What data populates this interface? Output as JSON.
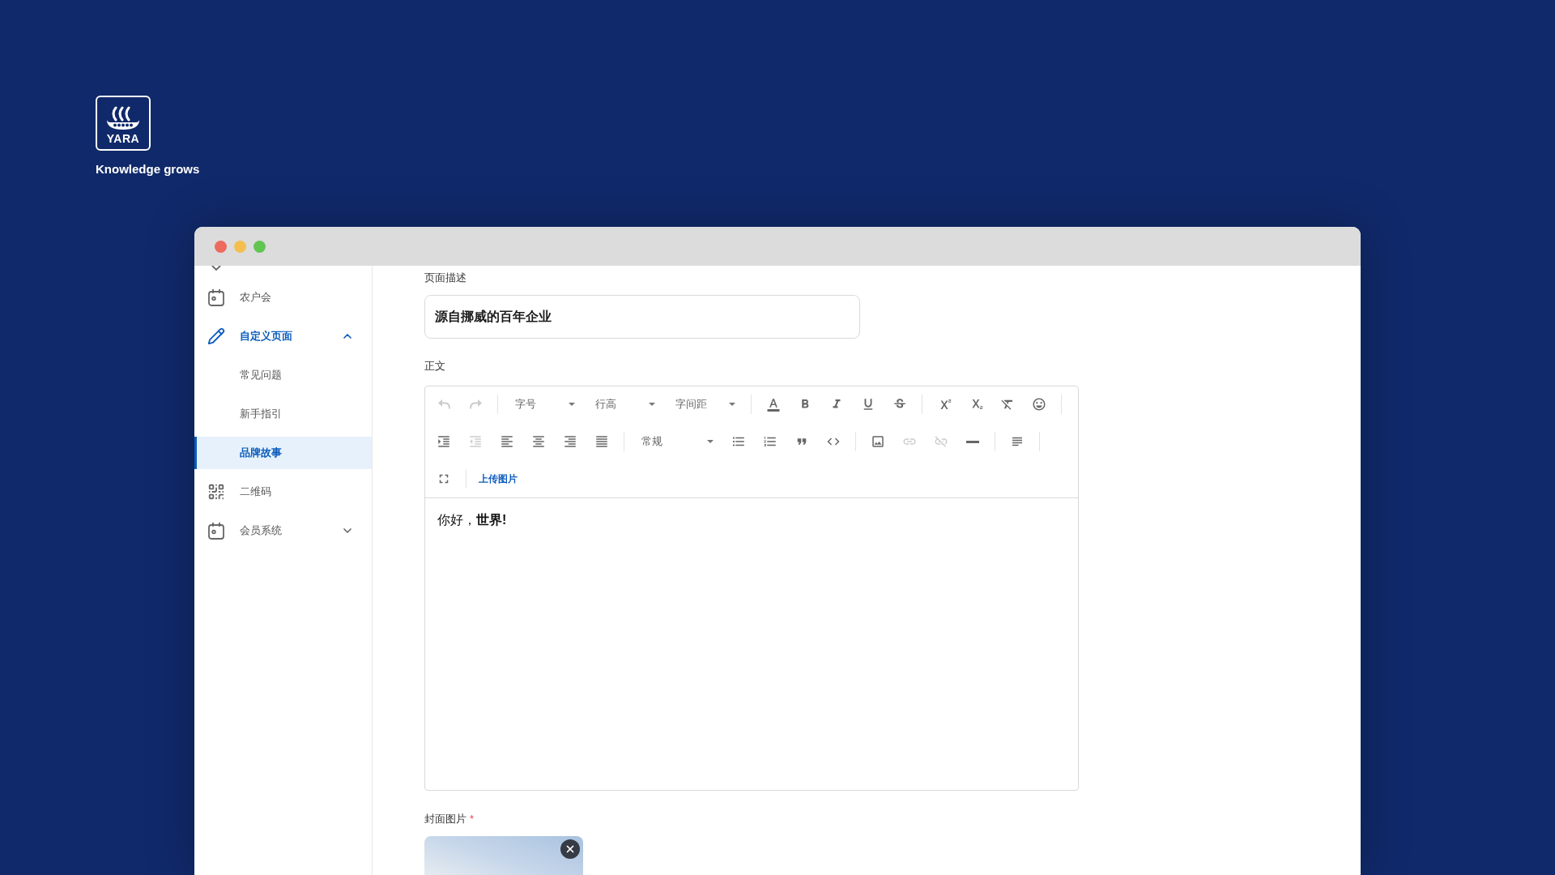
{
  "brand": {
    "logo_text": "YARA",
    "tagline": "Knowledge grows"
  },
  "sidebar": {
    "items": [
      {
        "label": "农户会",
        "selected": false
      },
      {
        "label": "自定义页面",
        "selected": false,
        "expanded": true,
        "children": [
          {
            "label": "常见问题",
            "selected": false
          },
          {
            "label": "新手指引",
            "selected": false
          },
          {
            "label": "品牌故事",
            "selected": true
          }
        ]
      },
      {
        "label": "二维码",
        "selected": false
      },
      {
        "label": "会员系统",
        "selected": false,
        "expanded": false
      }
    ]
  },
  "form": {
    "description": {
      "label": "页面描述",
      "value": "源自挪威的百年企业"
    },
    "body": {
      "label": "正文",
      "toolbar": {
        "rows": [
          {
            "items": [
              {
                "kind": "button",
                "disabled": true
              },
              {
                "kind": "button",
                "disabled": true
              },
              {
                "kind": "divider"
              },
              {
                "kind": "select",
                "label": "字号"
              },
              {
                "kind": "select",
                "label": "行高"
              },
              {
                "kind": "select",
                "label": "字间距"
              },
              {
                "kind": "divider"
              },
              {
                "kind": "button",
                "disabled": false
              },
              {
                "kind": "button",
                "disabled": false
              },
              {
                "kind": "button",
                "disabled": false
              },
              {
                "kind": "button",
                "disabled": false
              },
              {
                "kind": "button",
                "disabled": false
              },
              {
                "kind": "divider"
              },
              {
                "kind": "button",
                "disabled": false
              },
              {
                "kind": "button",
                "disabled": false
              },
              {
                "kind": "button",
                "disabled": false
              },
              {
                "kind": "button",
                "disabled": false
              },
              {
                "kind": "divider"
              }
            ]
          },
          {
            "items": [
              {
                "kind": "button",
                "disabled": false
              },
              {
                "kind": "button",
                "disabled": true
              },
              {
                "kind": "button",
                "disabled": false
              },
              {
                "kind": "button",
                "disabled": false
              },
              {
                "kind": "button",
                "disabled": false
              },
              {
                "kind": "button",
                "disabled": false
              },
              {
                "kind": "divider"
              },
              {
                "kind": "select",
                "label": "常规"
              },
              {
                "kind": "button",
                "disabled": false
              },
              {
                "kind": "button",
                "disabled": false
              },
              {
                "kind": "button",
                "disabled": false
              },
              {
                "kind": "button",
                "disabled": false
              },
              {
                "kind": "divider"
              },
              {
                "kind": "button",
                "disabled": false
              },
              {
                "kind": "button",
                "disabled": true
              },
              {
                "kind": "button",
                "disabled": true
              },
              {
                "kind": "button",
                "disabled": false
              },
              {
                "kind": "divider"
              },
              {
                "kind": "button",
                "disabled": false
              },
              {
                "kind": "divider"
              }
            ]
          },
          {
            "items": [
              {
                "kind": "button",
                "disabled": false
              },
              {
                "kind": "divider"
              },
              {
                "kind": "link",
                "label": "上传图片"
              }
            ]
          }
        ]
      },
      "content": "你好，**世界!**"
    },
    "cover": {
      "label": "封面图片",
      "required_mark": "*"
    }
  }
}
